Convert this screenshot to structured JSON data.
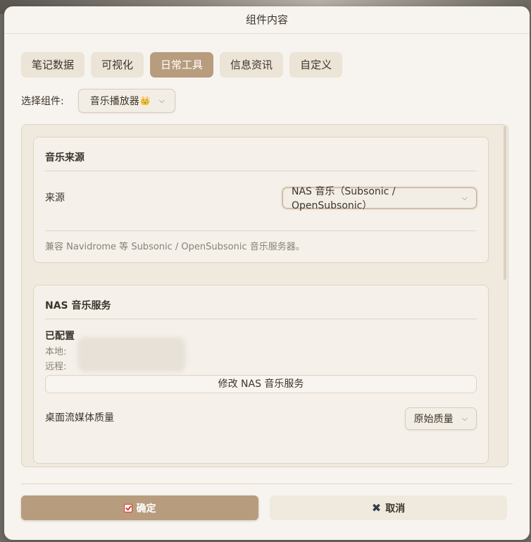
{
  "dialog": {
    "title": "组件内容"
  },
  "tabs": [
    {
      "label": "笔记数据"
    },
    {
      "label": "可视化"
    },
    {
      "label": "日常工具",
      "active": true
    },
    {
      "label": "信息资讯"
    },
    {
      "label": "自定义"
    }
  ],
  "picker": {
    "label": "选择组件:",
    "value": "音乐播放器",
    "value_icon": "👑"
  },
  "music_source": {
    "title": "音乐来源",
    "field_label": "来源",
    "select_value": "NAS 音乐（Subsonic / OpenSubsonic）",
    "hint": "兼容 Navidrome 等 Subsonic / OpenSubsonic 音乐服务器。"
  },
  "nas_service": {
    "title": "NAS 音乐服务",
    "status": "已配置",
    "local_label": "本地:",
    "remote_label": "远程:",
    "edit_button": "修改 NAS 音乐服务",
    "quality_label": "桌面流媒体质量",
    "quality_value": "原始质量"
  },
  "footer": {
    "ok_label": "确定",
    "cancel_label": "取消"
  },
  "icons": {
    "caret": "chevron-down-icon",
    "ok": "checkbox-icon",
    "cancel": "close-icon",
    "crown": "crown-icon"
  },
  "colors": {
    "accent": "#b89c7e",
    "panel": "#efe9de",
    "dialog_bg": "#f7f4ef"
  }
}
